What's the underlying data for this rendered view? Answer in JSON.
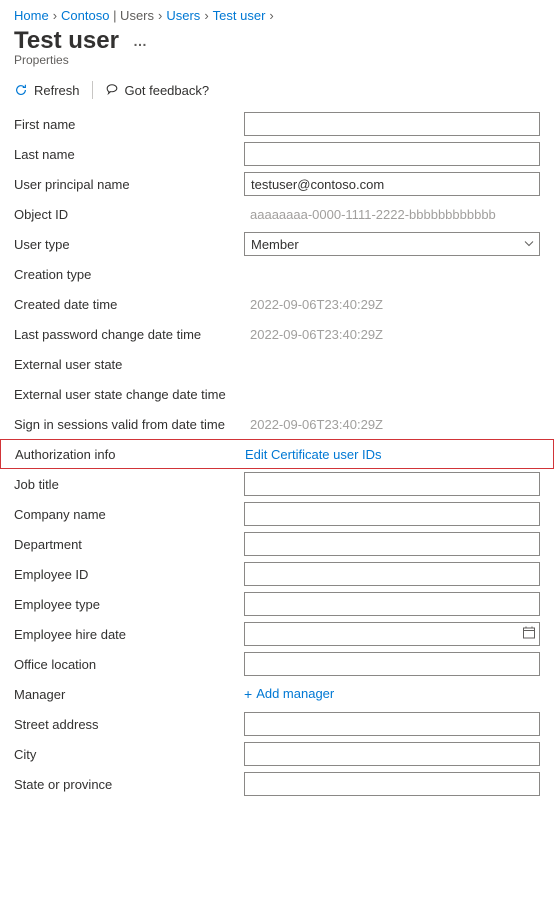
{
  "breadcrumb": [
    {
      "label": "Home",
      "link": true
    },
    {
      "label": "Contoso",
      "link": true,
      "suffix": "  | Users"
    },
    {
      "label": "Users",
      "link": true
    },
    {
      "label": "Test user",
      "link": true
    }
  ],
  "page_title": "Test user",
  "subtitle": "Properties",
  "toolbar": {
    "refresh": "Refresh",
    "feedback": "Got feedback?"
  },
  "fields": {
    "first_name": {
      "label": "First name",
      "value": "",
      "type": "text"
    },
    "last_name": {
      "label": "Last name",
      "value": "",
      "type": "text"
    },
    "upn": {
      "label": "User principal name",
      "value": "testuser@contoso.com",
      "type": "text"
    },
    "object_id": {
      "label": "Object ID",
      "value": "aaaaaaaa-0000-1111-2222-bbbbbbbbbbbb",
      "type": "readonly"
    },
    "user_type": {
      "label": "User type",
      "value": "Member",
      "type": "select"
    },
    "creation_type": {
      "label": "Creation type",
      "value": "",
      "type": "blank"
    },
    "created_date_time": {
      "label": "Created date time",
      "value": "2022-09-06T23:40:29Z",
      "type": "readonly"
    },
    "last_pw_change": {
      "label": "Last password change date time",
      "value": "2022-09-06T23:40:29Z",
      "type": "readonly"
    },
    "ext_user_state": {
      "label": "External user state",
      "value": "",
      "type": "blank"
    },
    "ext_user_state_change": {
      "label": "External user state change date time",
      "value": "",
      "type": "blank"
    },
    "signin_sessions": {
      "label": "Sign in sessions valid from date time",
      "value": "2022-09-06T23:40:29Z",
      "type": "readonly"
    },
    "auth_info": {
      "label": "Authorization info",
      "link_text": "Edit Certificate user IDs",
      "type": "link"
    },
    "job_title": {
      "label": "Job title",
      "value": "",
      "type": "text"
    },
    "company_name": {
      "label": "Company name",
      "value": "",
      "type": "text"
    },
    "department": {
      "label": "Department",
      "value": "",
      "type": "text"
    },
    "employee_id": {
      "label": "Employee ID",
      "value": "",
      "type": "text"
    },
    "employee_type": {
      "label": "Employee type",
      "value": "",
      "type": "text"
    },
    "employee_hire_date": {
      "label": "Employee hire date",
      "value": "",
      "type": "date"
    },
    "office_location": {
      "label": "Office location",
      "value": "",
      "type": "text"
    },
    "manager": {
      "label": "Manager",
      "link_text": "Add manager",
      "type": "addlink"
    },
    "street_address": {
      "label": "Street address",
      "value": "",
      "type": "text"
    },
    "city": {
      "label": "City",
      "value": "",
      "type": "text"
    },
    "state_province": {
      "label": "State or province",
      "value": "",
      "type": "text"
    }
  }
}
